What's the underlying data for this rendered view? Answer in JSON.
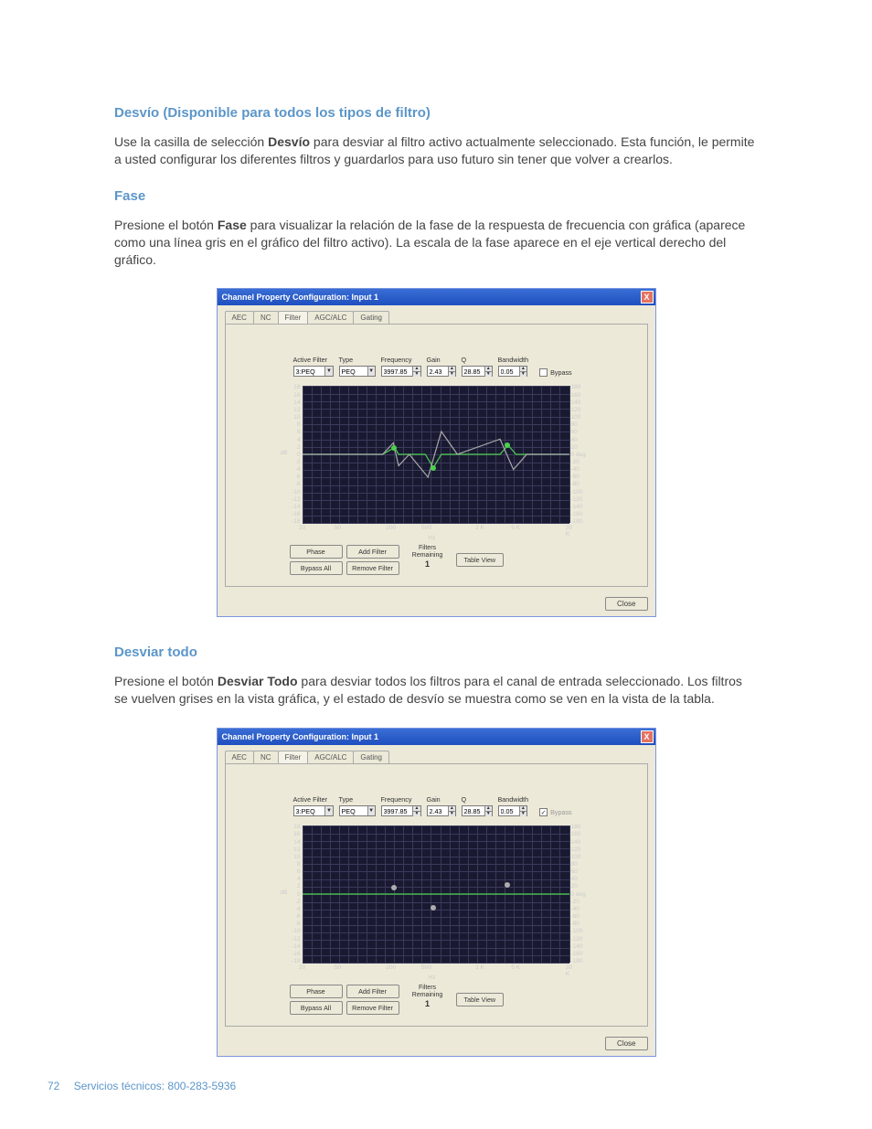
{
  "sections": {
    "desvio": {
      "heading": "Desvío (Disponible para todos los tipos de filtro)",
      "p1a": "Use la casilla de selección ",
      "p1b": "Desvío",
      "p1c": " para desviar al filtro activo actualmente seleccionado. Esta función, le permite a usted configurar los diferentes filtros y guardarlos para uso futuro sin tener que volver a crearlos."
    },
    "fase": {
      "heading": "Fase",
      "p1a": "Presione el botón ",
      "p1b": "Fase",
      "p1c": " para visualizar la relación de la fase de la respuesta de frecuencia con gráfica (aparece como una línea gris en el gráfico del filtro activo). La escala de la fase aparece en el eje vertical derecho del gráfico."
    },
    "desviartodo": {
      "heading": "Desviar todo",
      "p1a": "Presione el botón ",
      "p1b": "Desviar Todo",
      "p1c": " para desviar todos los filtros para el canal de entrada seleccionado. Los filtros se vuelven grises en la vista gráfica, y el estado de desvío se muestra como se ven en la vista de la tabla."
    }
  },
  "win": {
    "title": "Channel Property Configuration: Input 1",
    "close_x": "X",
    "tabs": [
      "AEC",
      "NC",
      "Filter",
      "AGC/ALC",
      "Gating"
    ],
    "params": {
      "active_filter": {
        "label": "Active Filter",
        "value": "3:PEQ"
      },
      "type": {
        "label": "Type",
        "value": "PEQ"
      },
      "frequency": {
        "label": "Frequency",
        "value": "3997.85"
      },
      "gain": {
        "label": "Gain",
        "value": "2.43"
      },
      "q": {
        "label": "Q",
        "value": "28.85"
      },
      "bandwidth": {
        "label": "Bandwidth",
        "value": "0.05"
      },
      "bypass": {
        "label": "Bypass"
      }
    },
    "buttons": {
      "phase": "Phase",
      "bypass_all": "Bypass All",
      "add_filter": "Add Filter",
      "remove_filter": "Remove Filter",
      "table_view": "Table View",
      "close": "Close"
    },
    "filters_remaining": {
      "label": "Filters Remaining",
      "value": "1"
    }
  },
  "chart_data": {
    "type": "line",
    "xlabel": "Hz",
    "ylabel": "dB",
    "y_ticks_left": [
      "18",
      "16",
      "14",
      "12",
      "10",
      "8",
      "6",
      "4",
      "2",
      "0",
      "-2",
      "-4",
      "-6",
      "-8",
      "-10",
      "-12",
      "-14",
      "-16",
      "-18"
    ],
    "y_ticks_right": [
      "180",
      "160",
      "140",
      "120",
      "100",
      "80",
      "60",
      "40",
      "20",
      "0 deg",
      "-20",
      "-40",
      "-60",
      "-80",
      "-100",
      "-120",
      "-140",
      "-160",
      "-180"
    ],
    "x_ticks": [
      {
        "label": "20",
        "pos": 0.0
      },
      {
        "label": "50",
        "pos": 0.133
      },
      {
        "label": "200",
        "pos": 0.333
      },
      {
        "label": "500",
        "pos": 0.466
      },
      {
        "label": "2 K",
        "pos": 0.666
      },
      {
        "label": "5 K",
        "pos": 0.8
      },
      {
        "label": "20 K",
        "pos": 1.0
      }
    ],
    "screenshot_a": {
      "series": [
        {
          "name": "response-active",
          "color": "#4dcf4d",
          "points": [
            [
              0,
              0
            ],
            [
              0.3,
              0
            ],
            [
              0.345,
              1.8
            ],
            [
              0.36,
              0
            ],
            [
              0.46,
              0
            ],
            [
              0.49,
              -3.5
            ],
            [
              0.52,
              0
            ],
            [
              0.74,
              0
            ],
            [
              0.77,
              2.4
            ],
            [
              0.8,
              0
            ],
            [
              1.0,
              0
            ]
          ]
        },
        {
          "name": "phase",
          "color": "#a9a9a9",
          "points": [
            [
              0,
              0
            ],
            [
              0.3,
              0
            ],
            [
              0.34,
              30
            ],
            [
              0.36,
              -30
            ],
            [
              0.4,
              0
            ],
            [
              0.47,
              -60
            ],
            [
              0.52,
              60
            ],
            [
              0.58,
              0
            ],
            [
              0.74,
              40
            ],
            [
              0.79,
              -40
            ],
            [
              0.84,
              0
            ],
            [
              1.0,
              0
            ]
          ]
        }
      ],
      "nodes": [
        {
          "x": 0.345,
          "y": 1.8,
          "color": "green"
        },
        {
          "x": 0.49,
          "y": -3.5,
          "color": "green"
        },
        {
          "x": 0.77,
          "y": 2.4,
          "color": "green"
        }
      ]
    },
    "screenshot_b": {
      "series": [
        {
          "name": "response-bypassed",
          "color": "#4dcf4d",
          "points": [
            [
              0,
              0
            ],
            [
              1.0,
              0
            ]
          ]
        }
      ],
      "nodes": [
        {
          "x": 0.345,
          "y": 1.8,
          "color": "grey"
        },
        {
          "x": 0.49,
          "y": -3.5,
          "color": "grey"
        },
        {
          "x": 0.77,
          "y": 2.4,
          "color": "grey"
        }
      ]
    }
  },
  "footer": {
    "page": "72",
    "text": "Servicios técnicos: 800-283-5936"
  }
}
